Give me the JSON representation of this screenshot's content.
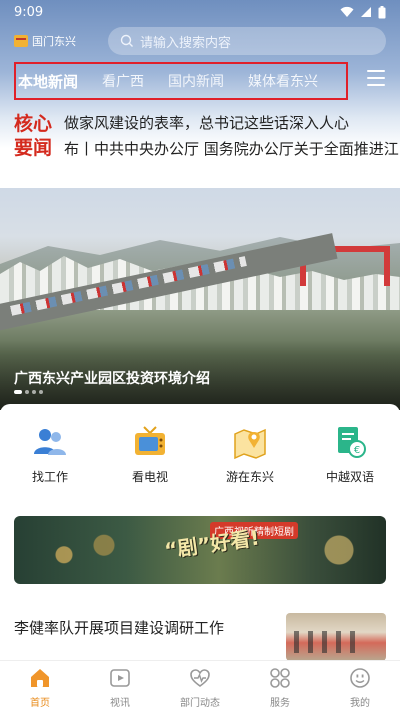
{
  "status_bar": {
    "time": "9:09"
  },
  "header": {
    "app_name": "国门东兴",
    "search_placeholder": "请输入搜索内容"
  },
  "tabs": [
    {
      "label": "本地新闻",
      "active": true
    },
    {
      "label": "看广西",
      "active": false
    },
    {
      "label": "国内新闻",
      "active": false
    },
    {
      "label": "媒体看东兴",
      "active": false
    }
  ],
  "core_news": {
    "label_line1": "核心",
    "label_line2": "要闻",
    "items": [
      "做家风建设的表率，总书记这些话深入人心",
      "布丨中共中央办公厅 国务院办公厅关于全面推进江"
    ]
  },
  "banner": {
    "caption": "广西东兴产业园区投资环境介绍",
    "slide_count": 4,
    "active_slide": 1
  },
  "services": [
    {
      "label": "找工作",
      "icon": "people-icon"
    },
    {
      "label": "看电视",
      "icon": "tv-icon"
    },
    {
      "label": "游在东兴",
      "icon": "map-icon"
    },
    {
      "label": "中越双语",
      "icon": "bilingual-doc-icon"
    }
  ],
  "promo": {
    "headline": "“剧”好看!",
    "badge": "广西视听精制短剧"
  },
  "news_list": [
    {
      "title": "李健率队开展项目建设调研工作"
    }
  ],
  "bottom_nav": [
    {
      "label": "首页",
      "icon": "home-icon",
      "active": true
    },
    {
      "label": "视讯",
      "icon": "play-icon",
      "active": false
    },
    {
      "label": "部门动态",
      "icon": "heart-pulse-icon",
      "active": false
    },
    {
      "label": "服务",
      "icon": "grid-icon",
      "active": false
    },
    {
      "label": "我的",
      "icon": "face-icon",
      "active": false
    }
  ],
  "colors": {
    "accent": "#e88b1b",
    "core_red": "#d42a1e",
    "highlight_border": "#e0202a"
  }
}
